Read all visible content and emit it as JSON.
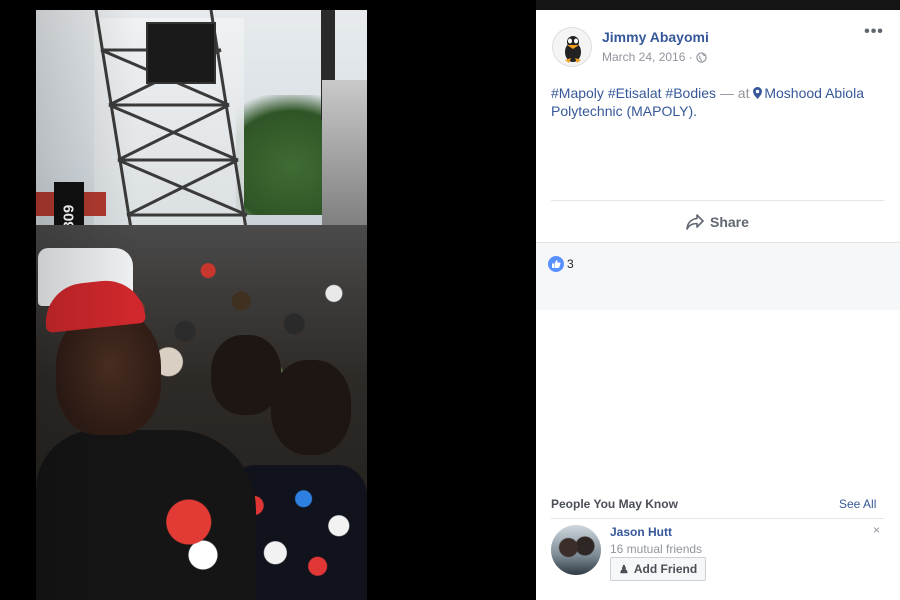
{
  "photo": {
    "sign_text": "0809"
  },
  "post": {
    "author": "Jimmy Abayomi",
    "date": "March 24, 2016 ·",
    "more_label": "•••",
    "hashtags": [
      "#Mapoly",
      "#Etisalat",
      "#Bodies"
    ],
    "at_text": "— at",
    "place": "Moshood Abiola Polytechnic (MAPOLY)."
  },
  "actions": {
    "share_label": "Share"
  },
  "reactions": {
    "count": "3"
  },
  "pymk": {
    "title": "People You May Know",
    "see_all": "See All",
    "friend": {
      "name": "Jason Hutt",
      "mutual": "16 mutual friends",
      "add_label": "Add Friend",
      "dismiss": "×"
    }
  },
  "colors": {
    "link": "#365899",
    "like_blue": "#5890ff",
    "muted": "#90949c"
  },
  "icons": [
    "globe-icon",
    "more-icon",
    "location-pin-icon",
    "share-icon",
    "like-icon",
    "add-friend-icon",
    "close-icon"
  ]
}
